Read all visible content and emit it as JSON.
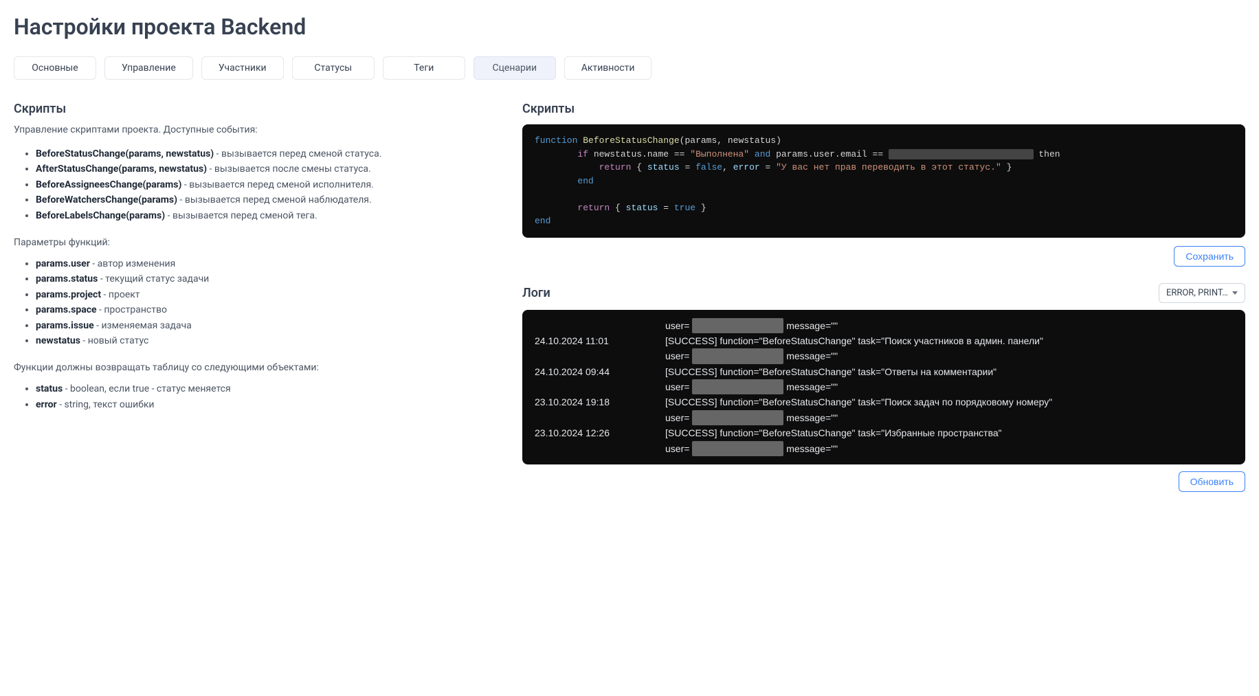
{
  "page": {
    "title": "Настройки проекта Backend"
  },
  "tabs": [
    {
      "label": "Основные",
      "active": false
    },
    {
      "label": "Управление",
      "active": false
    },
    {
      "label": "Участники",
      "active": false
    },
    {
      "label": "Статусы",
      "active": false
    },
    {
      "label": "Теги",
      "active": false
    },
    {
      "label": "Сценарии",
      "active": true
    },
    {
      "label": "Активности",
      "active": false
    }
  ],
  "left": {
    "title": "Скрипты",
    "desc": "Управление скриптами проекта. Доступные события:",
    "events": [
      {
        "name": "BeforeStatusChange(params, newstatus)",
        "desc": " - вызывается перед сменой статуса."
      },
      {
        "name": "AfterStatusChange(params, newstatus)",
        "desc": " - вызывается после смены статуса."
      },
      {
        "name": "BeforeAssigneesChange(params)",
        "desc": " - вызывается перед сменой исполнителя."
      },
      {
        "name": "BeforeWatchersChange(params)",
        "desc": " - вызывается перед сменой наблюдателя."
      },
      {
        "name": "BeforeLabelsChange(params)",
        "desc": " - вызывается перед сменой тега."
      }
    ],
    "params_heading": "Параметры функций:",
    "params": [
      {
        "name": "params.user",
        "desc": " - автор изменения"
      },
      {
        "name": "params.status",
        "desc": " - текущий статус задачи"
      },
      {
        "name": "params.project",
        "desc": " - проект"
      },
      {
        "name": "params.space",
        "desc": " - пространство"
      },
      {
        "name": "params.issue",
        "desc": " - изменяемая задача"
      },
      {
        "name": "newstatus",
        "desc": " - новый статус"
      }
    ],
    "return_heading": "Функции должны возвращать таблицу со следующими объектами:",
    "returns": [
      {
        "name": "status",
        "desc": " - boolean, если true - статус меняется"
      },
      {
        "name": "error",
        "desc": " - string, текст ошибки"
      }
    ]
  },
  "right": {
    "scripts_title": "Скрипты",
    "code": {
      "function_kw": "function",
      "function_name": "BeforeStatusChange",
      "function_params": "(params, newstatus)",
      "if_kw": "if",
      "cond1_left": " newstatus.name == ",
      "cond1_str": "\"Выполнена\"",
      "and_kw": " and ",
      "cond2": "params.user.email == ",
      "redacted_email": "xxxxxxxxxxxxxxxxxxxxxxxxxxx",
      "then_kw": " then",
      "return1_kw": "return",
      "return1_body_open": " { ",
      "status_prop": "status",
      "eq_false": " = ",
      "false_kw": "false",
      "comma": ", ",
      "error_prop": "error",
      "eq_err": " = ",
      "error_str": "\"У вас нет прав переводить в этот статус.\"",
      "return1_body_close": " }",
      "end1": "end",
      "return2_kw": "return",
      "return2_open": " { ",
      "status2_prop": "status",
      "eq_true": " = ",
      "true_kw": "true",
      "return2_close": " }",
      "end2": "end"
    },
    "save_button": "Сохранить",
    "logs_title": "Логи",
    "logs_filter": "ERROR, PRINT…",
    "logs": [
      {
        "date": "",
        "msg_pre": "user= ",
        "redacted": "xxxxxxxxxxxxxxxxxxx",
        "msg_post": " message=\"\""
      },
      {
        "date": "24.10.2024 11:01",
        "msg_pre": "[SUCCESS] function=\"BeforeStatusChange\" task=\"Поиск участников в админ. панели\"",
        "redacted": "",
        "msg_post": ""
      },
      {
        "date": "",
        "msg_pre": "user= ",
        "redacted": "xxxxxxxxxxxxxxxxxxx",
        "msg_post": " message=\"\""
      },
      {
        "date": "24.10.2024 09:44",
        "msg_pre": "[SUCCESS] function=\"BeforeStatusChange\" task=\"Ответы на комментарии\"",
        "redacted": "",
        "msg_post": ""
      },
      {
        "date": "",
        "msg_pre": "user= ",
        "redacted": "xxxxxxxxxxxxxxxxxxx",
        "msg_post": " message=\"\""
      },
      {
        "date": "23.10.2024 19:18",
        "msg_pre": "[SUCCESS] function=\"BeforeStatusChange\" task=\"Поиск задач по порядковому номеру\"",
        "redacted": "",
        "msg_post": ""
      },
      {
        "date": "",
        "msg_pre": "user= ",
        "redacted": "xxxxxxxxxxxxxxxxxxx",
        "msg_post": " message=\"\""
      },
      {
        "date": "23.10.2024 12:26",
        "msg_pre": "[SUCCESS] function=\"BeforeStatusChange\" task=\"Избранные пространства\"",
        "redacted": "",
        "msg_post": ""
      },
      {
        "date": "",
        "msg_pre": "user= ",
        "redacted": "xxxxxxxxxxxxxxxxxxx",
        "msg_post": " message=\"\""
      }
    ],
    "refresh_button": "Обновить"
  }
}
